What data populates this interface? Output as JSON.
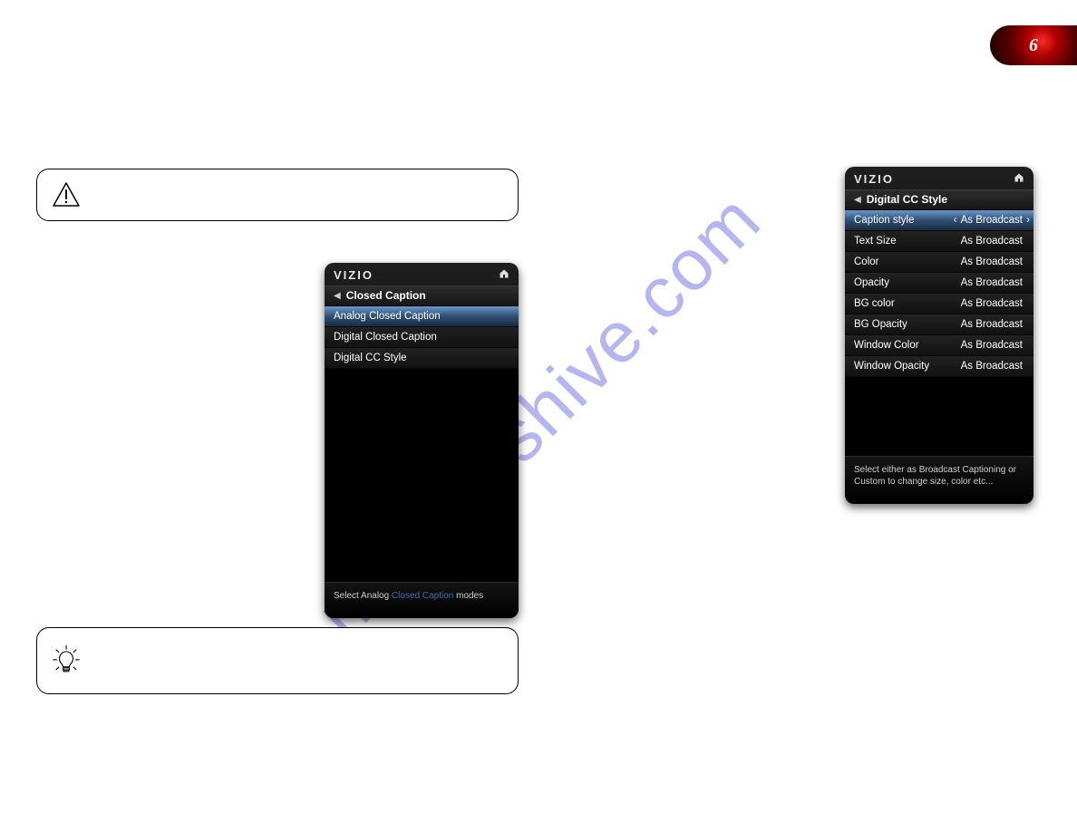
{
  "corner": {
    "number": "6"
  },
  "watermark": "manualshive.com",
  "panel_left": {
    "brand": "VIZIO",
    "breadcrumb": "Closed Caption",
    "items": [
      {
        "label": "Analog Closed Caption",
        "selected": true
      },
      {
        "label": "Digital Closed Caption",
        "selected": false
      },
      {
        "label": "Digital CC Style",
        "selected": false
      }
    ],
    "footer_prefix": "Select Analog ",
    "footer_highlight": "Closed Caption",
    "footer_suffix": " modes"
  },
  "panel_right": {
    "brand": "VIZIO",
    "breadcrumb": "Digital CC Style",
    "rows": [
      {
        "label": "Caption style",
        "value": "As Broadcast",
        "selected": true
      },
      {
        "label": "Text Size",
        "value": "As Broadcast",
        "selected": false
      },
      {
        "label": "Color",
        "value": "As Broadcast",
        "selected": false
      },
      {
        "label": "Opacity",
        "value": "As Broadcast",
        "selected": false
      },
      {
        "label": "BG color",
        "value": "As Broadcast",
        "selected": false
      },
      {
        "label": "BG Opacity",
        "value": "As Broadcast",
        "selected": false
      },
      {
        "label": "Window Color",
        "value": "As Broadcast",
        "selected": false
      },
      {
        "label": "Window Opacity",
        "value": "As Broadcast",
        "selected": false
      }
    ],
    "footer": "Select either as Broadcast Captioning or Custom to change size, color etc..."
  }
}
